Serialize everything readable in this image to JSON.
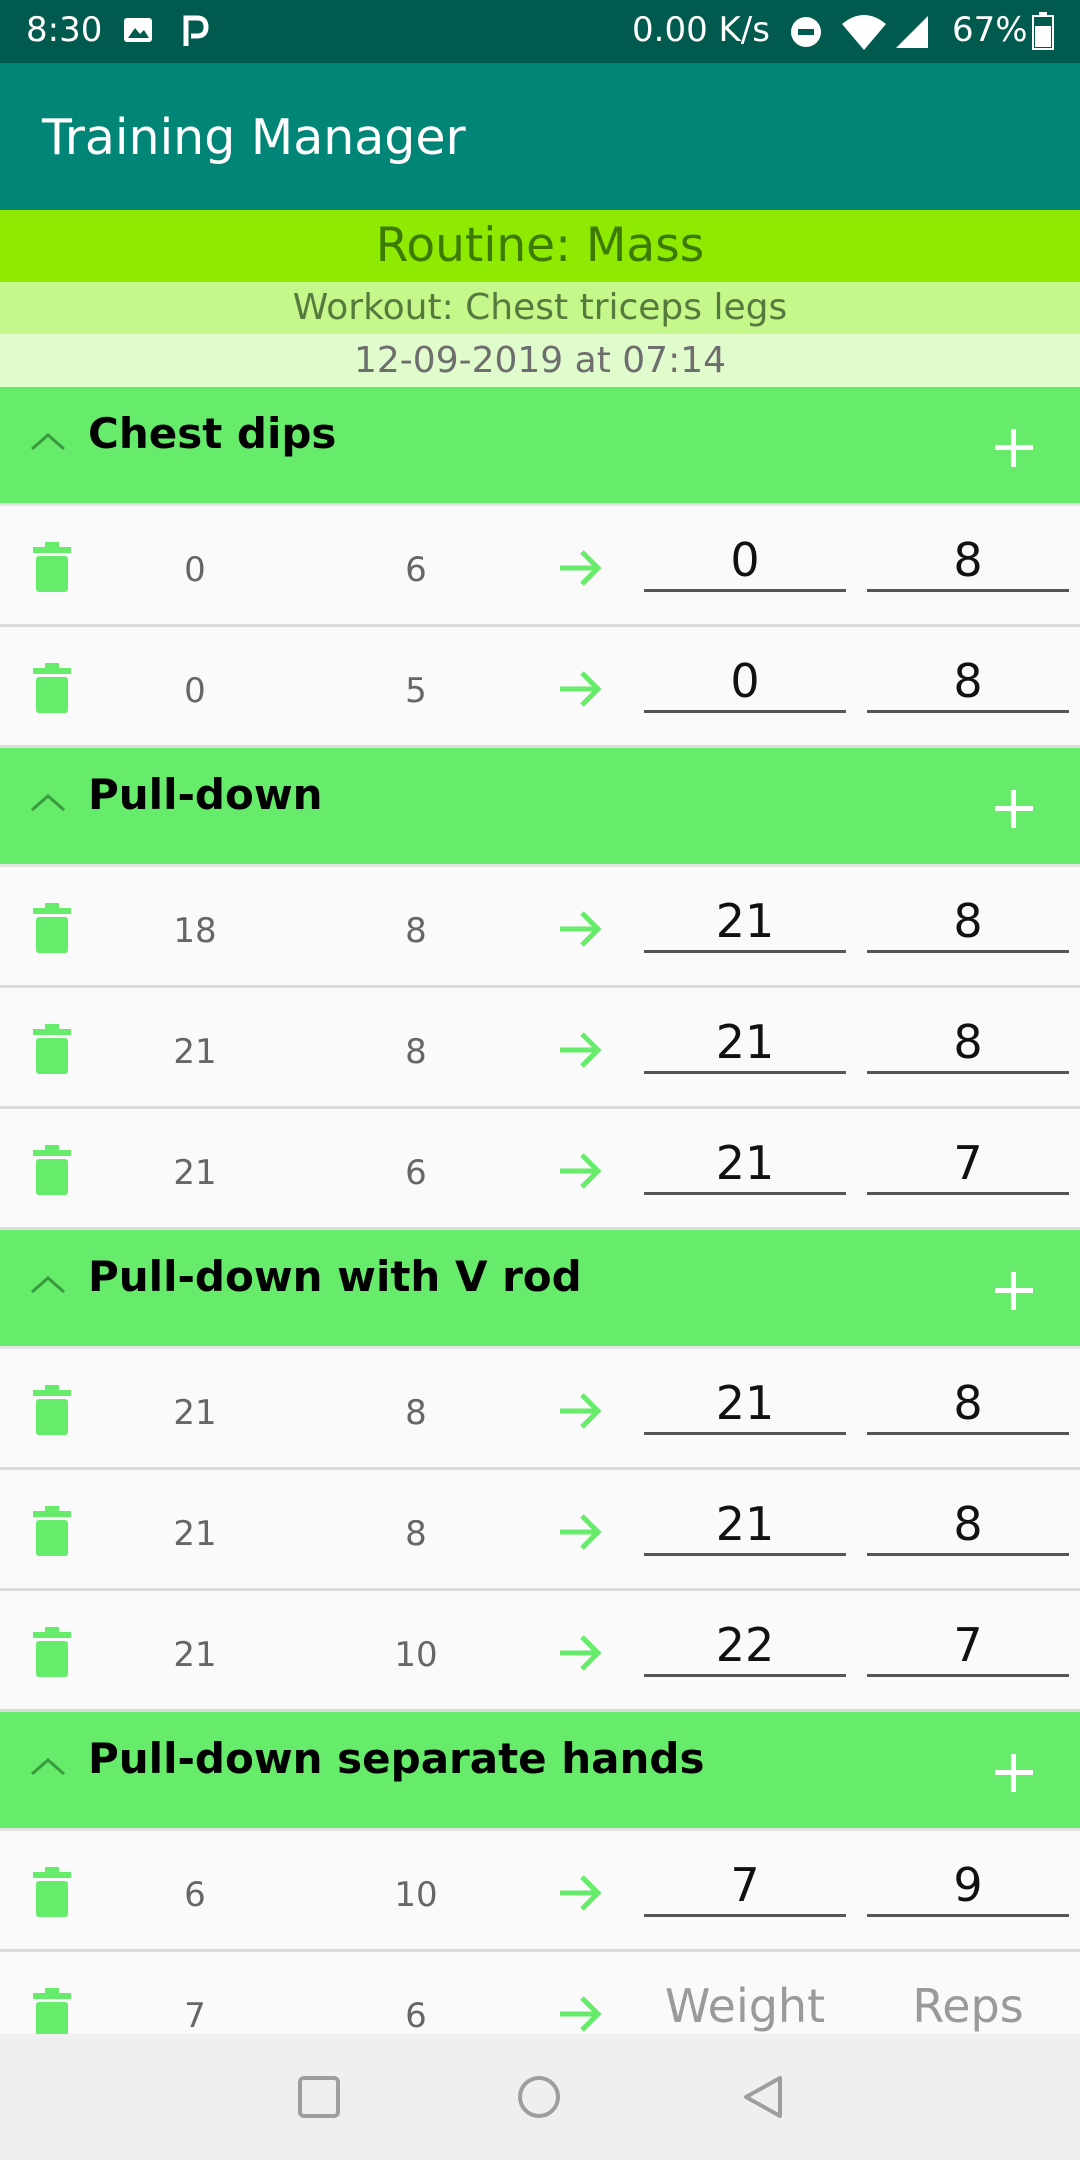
{
  "status_bar": {
    "time": "8:30",
    "net_speed": "0.00 K/s",
    "battery": "67%",
    "icons": [
      "image-icon",
      "p-icon",
      "dnd-icon",
      "wifi-icon",
      "signal-icon",
      "battery-icon"
    ]
  },
  "app": {
    "title": "Training Manager"
  },
  "routine": {
    "label": "Routine: Mass"
  },
  "workout": {
    "label": "Workout: Chest triceps legs"
  },
  "session": {
    "date": "12-09-2019 at 07:14"
  },
  "colors": {
    "status_bar": "#005a4e",
    "app_bar": "#008577",
    "routine_bg": "#8eea00",
    "workout_bg": "#c6f78a",
    "date_bg": "#e0fbcc",
    "exercise_header": "#66eb6a",
    "accent_green": "#66eb6a"
  },
  "exercises": [
    {
      "name": "Chest dips",
      "sets": [
        {
          "prev_weight": "0",
          "prev_reps": "6",
          "weight": "0",
          "reps": "8"
        },
        {
          "prev_weight": "0",
          "prev_reps": "5",
          "weight": "0",
          "reps": "8"
        }
      ]
    },
    {
      "name": "Pull-down",
      "sets": [
        {
          "prev_weight": "18",
          "prev_reps": "8",
          "weight": "21",
          "reps": "8"
        },
        {
          "prev_weight": "21",
          "prev_reps": "8",
          "weight": "21",
          "reps": "8"
        },
        {
          "prev_weight": "21",
          "prev_reps": "6",
          "weight": "21",
          "reps": "7"
        }
      ]
    },
    {
      "name": "Pull-down with V rod",
      "sets": [
        {
          "prev_weight": "21",
          "prev_reps": "8",
          "weight": "21",
          "reps": "8"
        },
        {
          "prev_weight": "21",
          "prev_reps": "8",
          "weight": "21",
          "reps": "8"
        },
        {
          "prev_weight": "21",
          "prev_reps": "10",
          "weight": "22",
          "reps": "7"
        }
      ]
    },
    {
      "name": "Pull-down separate hands",
      "sets": [
        {
          "prev_weight": "6",
          "prev_reps": "10",
          "weight": "7",
          "reps": "9"
        },
        {
          "prev_weight": "7",
          "prev_reps": "6",
          "weight": "",
          "reps": "",
          "weight_placeholder": "Weight",
          "reps_placeholder": "Reps"
        }
      ]
    }
  ]
}
